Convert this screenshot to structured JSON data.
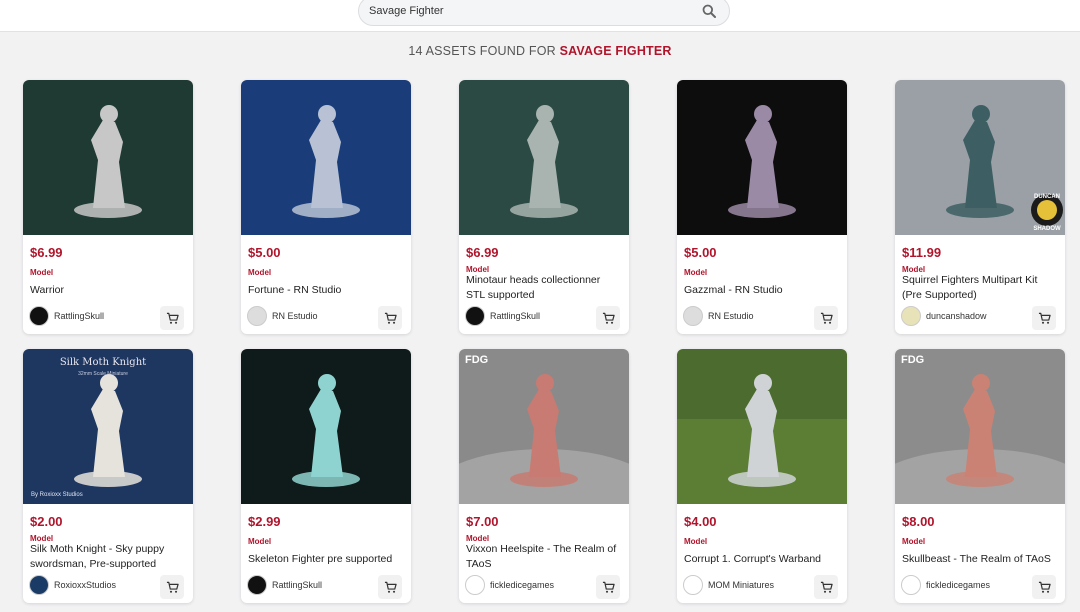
{
  "search": {
    "value": "Savage Fighter"
  },
  "results": {
    "count_text": "14 ASSETS FOUND FOR",
    "term": "SAVAGE FIGHTER"
  },
  "products": [
    {
      "price": "$6.99",
      "type": "Model",
      "name": "Warrior",
      "seller": "RattlingSkull",
      "image": "warrior-miniature",
      "thumb_bg": "#1f3a33",
      "figure": "#c7c7c7",
      "avatar_bg": "#111111"
    },
    {
      "price": "$5.00",
      "type": "Model",
      "name": "Fortune - RN Studio",
      "seller": "RN Estudio",
      "image": "fortune-miniature",
      "thumb_bg": "#1a3d7a",
      "figure": "#b8c2d4",
      "avatar_bg": "#dddddd"
    },
    {
      "price": "$6.99",
      "type": "Model",
      "name": "Minotaur heads collectionner STL supported",
      "seller": "RattlingSkull",
      "image": "minotaur-heads",
      "thumb_bg": "#2b4a44",
      "figure": "#a9b4b0",
      "avatar_bg": "#111111"
    },
    {
      "price": "$5.00",
      "type": "Model",
      "name": "Gazzmal - RN Studio",
      "seller": "RN Estudio",
      "image": "gazzmal-miniature",
      "thumb_bg": "#0d0d0d",
      "figure": "#9b8aa6",
      "avatar_bg": "#dddddd"
    },
    {
      "price": "$11.99",
      "type": "Model",
      "name": "Squirrel Fighters Multipart Kit (Pre Supported)",
      "seller": "duncanshadow",
      "image": "squirrel-kit",
      "thumb_bg": "#9aa0a6",
      "figure": "#3d5f63",
      "avatar_bg": "#e7e2b8"
    },
    {
      "price": "$2.00",
      "type": "Model",
      "name": "Silk Moth Knight - Sky puppy swordsman, Pre-supported",
      "seller": "RoxioxxStudios",
      "image": "silk-moth-knight",
      "thumb_bg": "#1e3760",
      "figure": "#e6e3dc",
      "avatar_bg": "#1a3b66"
    },
    {
      "price": "$2.99",
      "type": "Model",
      "name": "Skeleton Fighter pre supported",
      "seller": "RattlingSkull",
      "image": "skeleton-fighter",
      "thumb_bg": "#0f1a1a",
      "figure": "#8fd3d0",
      "avatar_bg": "#111111"
    },
    {
      "price": "$7.00",
      "type": "Model",
      "name": "Vixxon Heelspite - The Realm of TAoS",
      "seller": "fickledicegames",
      "image": "vixxon-heelspite",
      "thumb_bg": "#8a8a8a",
      "figure": "#c77b72",
      "avatar_bg": "#ffffff"
    },
    {
      "price": "$4.00",
      "type": "Model",
      "name": "Corrupt 1. Corrupt's Warband",
      "seller": "MOM Miniatures",
      "image": "corrupt-warband",
      "thumb_bg": "#4c6b2e",
      "figure": "#d0d3d6",
      "avatar_bg": "#ffffff"
    },
    {
      "price": "$8.00",
      "type": "Model",
      "name": "Skullbeast - The Realm of TAoS",
      "seller": "fickledicegames",
      "image": "skullbeast",
      "thumb_bg": "#8c8c8c",
      "figure": "#c98274",
      "avatar_bg": "#ffffff"
    }
  ],
  "thumb_overlay_text": {
    "silk_moth_title": "Silk Moth Knight",
    "silk_moth_sub": "32mm Scale Miniature",
    "silk_moth_credit": "By Roxioxx Studios",
    "fdg_logo": "FDG",
    "duncan_logo_top": "DUNCAN",
    "duncan_logo_bottom": "SHADOW"
  }
}
